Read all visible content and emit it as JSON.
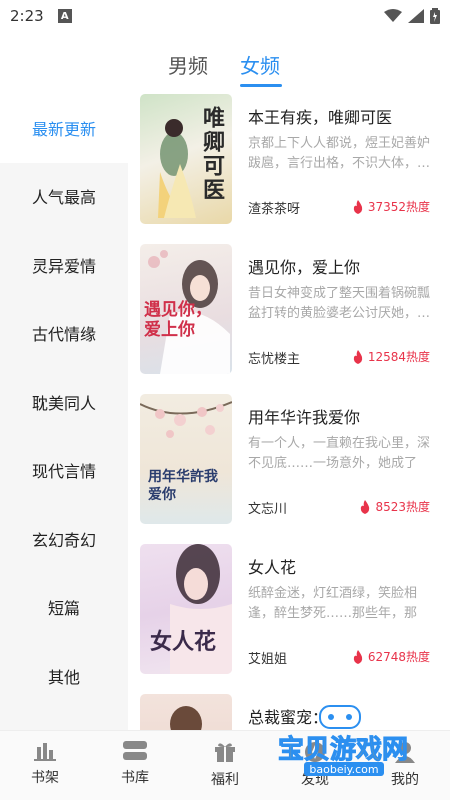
{
  "status": {
    "time": "2:23",
    "notif_letter": "A"
  },
  "tabs": [
    {
      "label": "男频"
    },
    {
      "label": "女频"
    }
  ],
  "sidebar": {
    "items": [
      {
        "label": "最新更新"
      },
      {
        "label": "人气最高"
      },
      {
        "label": "灵异爱情"
      },
      {
        "label": "古代情缘"
      },
      {
        "label": "耽美同人"
      },
      {
        "label": "现代言情"
      },
      {
        "label": "玄幻奇幻"
      },
      {
        "label": "短篇"
      },
      {
        "label": "其他"
      }
    ]
  },
  "books": [
    {
      "title": "本王有疾，唯卿可医",
      "desc": "京都上下人人都说，煜王妃善妒跋扈，言行出格，不识大体，…",
      "author": "渣茶茶呀",
      "heat": "37352热度",
      "cover_text": "唯卿可医"
    },
    {
      "title": "遇见你，爱上你",
      "desc": "昔日女神变成了整天围着锅碗瓢盆打转的黄脸婆老公讨厌她，…",
      "author": "忘忧楼主",
      "heat": "12584热度",
      "cover_text": "遇见你，爱上你"
    },
    {
      "title": "用年华许我爱你",
      "desc": "有一个人，一直赖在我心里，深不见底……一场意外，她成了他…",
      "author": "文忘川",
      "heat": "8523热度",
      "cover_text": "用年华許我爱你"
    },
    {
      "title": "女人花",
      "desc": "纸醉金迷，灯红酒绿，笑脸相逢，醉生梦死……那些年，那一…",
      "author": "艾姐姐",
      "heat": "62748热度",
      "cover_text": "女人花"
    },
    {
      "title": "总裁蜜宠：",
      "desc": "",
      "author": "",
      "heat": "",
      "cover_text": ""
    }
  ],
  "bottom_nav": [
    {
      "label": "书架",
      "icon": "bookshelf-icon"
    },
    {
      "label": "书库",
      "icon": "library-icon"
    },
    {
      "label": "福利",
      "icon": "gift-icon"
    },
    {
      "label": "发现",
      "icon": "discover-icon"
    },
    {
      "label": "我的",
      "icon": "profile-icon"
    }
  ],
  "watermark": {
    "title": "宝贝游戏网",
    "url": "baobeiy.com"
  },
  "colors": {
    "accent": "#2b8ff0",
    "heat": "#e8334a",
    "sidebar_bg": "#f6f6f6"
  }
}
